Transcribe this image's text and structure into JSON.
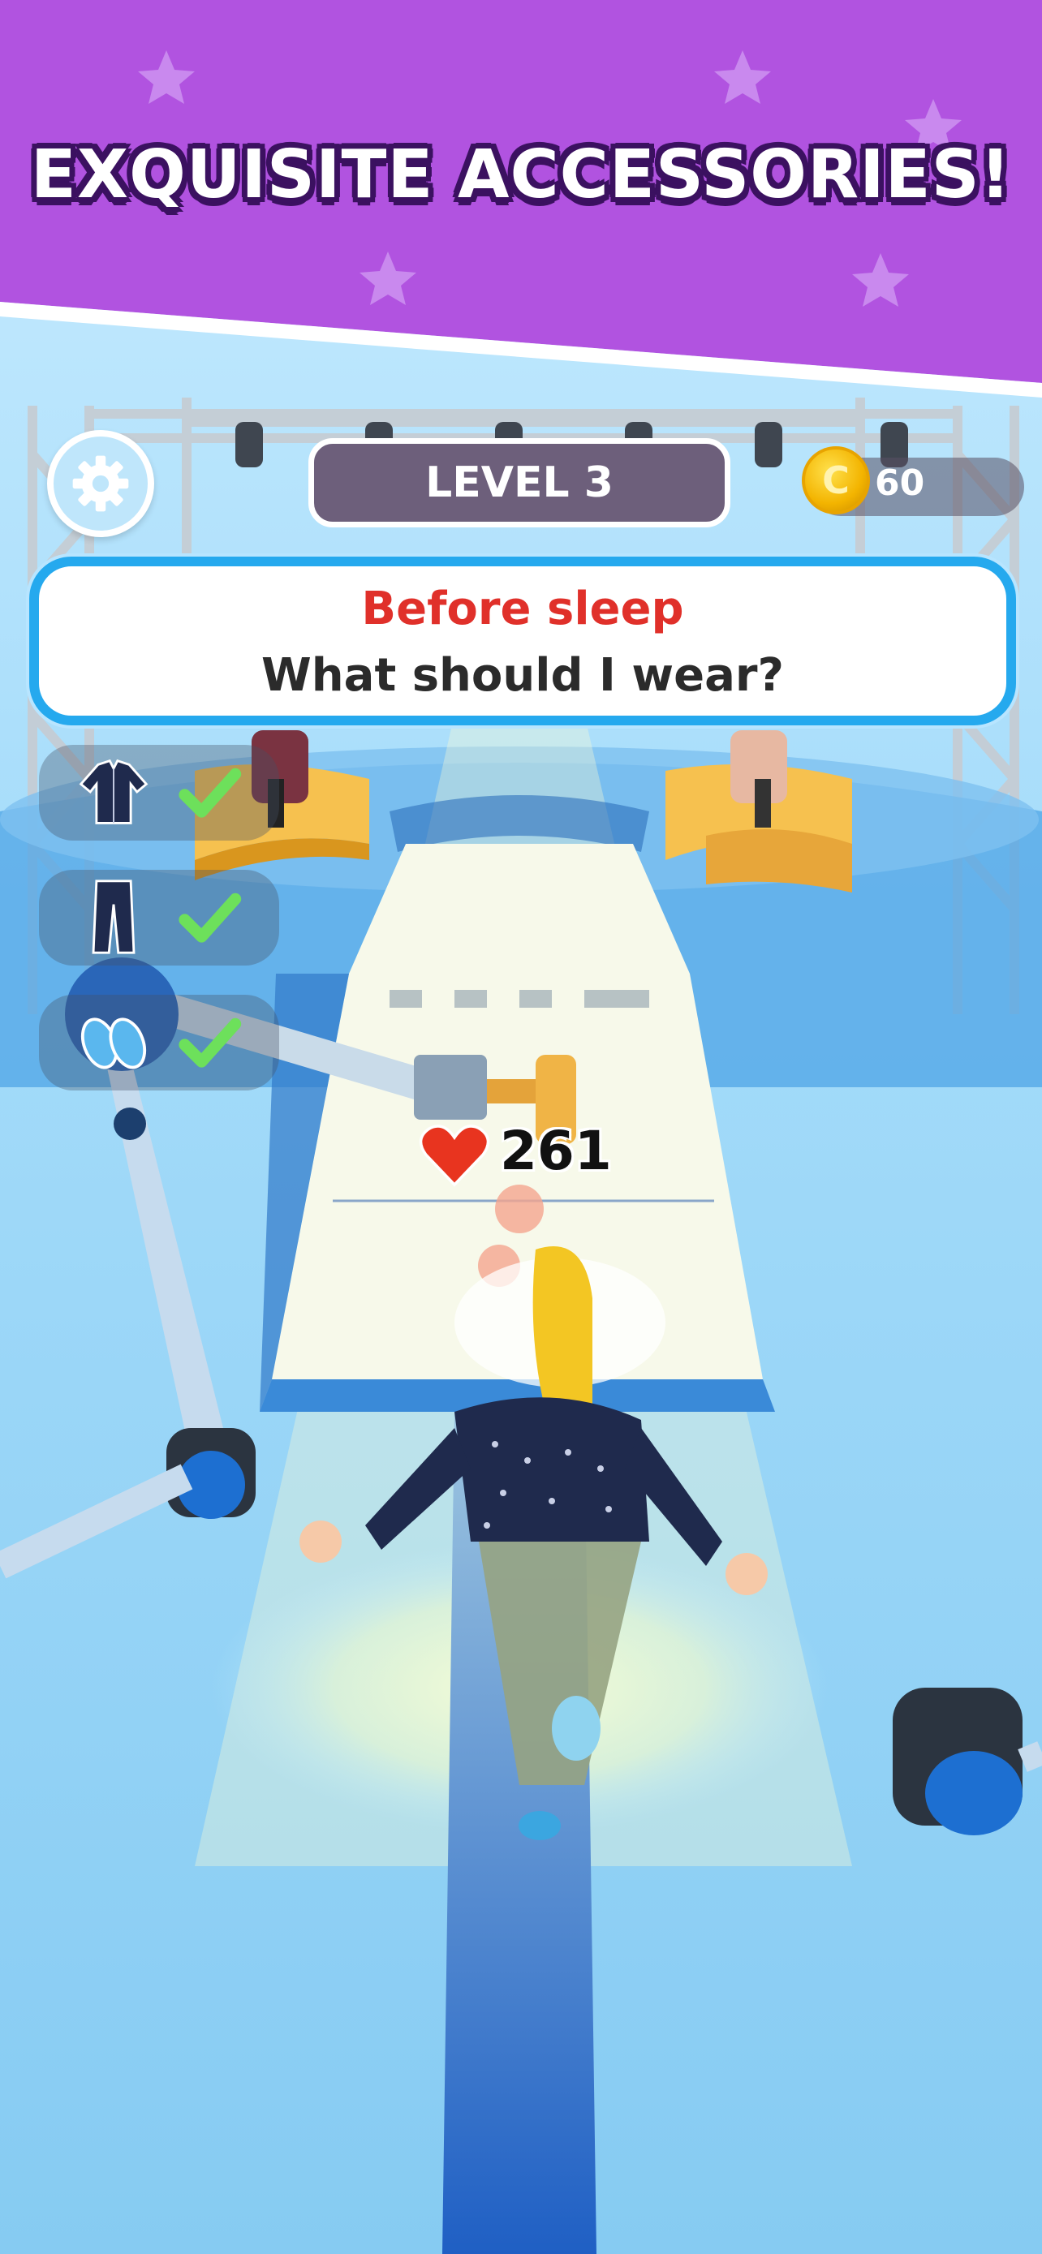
{
  "banner": {
    "title": "EXQUISITE ACCESSORIES!",
    "colors": {
      "background": "#b153e0",
      "text": "#ffffff",
      "outline": "#3b1160"
    }
  },
  "hud": {
    "settings_icon": "gear-icon",
    "level_label": "LEVEL 3",
    "coin_symbol": "C",
    "coins": "60"
  },
  "question": {
    "title": "Before sleep",
    "text": "What should I wear?"
  },
  "outfit_slots": [
    {
      "item": "pajama-shirt-icon",
      "status": "check-icon"
    },
    {
      "item": "pajama-pants-icon",
      "status": "check-icon"
    },
    {
      "item": "slippers-icon",
      "status": "check-icon"
    }
  ],
  "score": {
    "icon": "heart-icon",
    "value": "261"
  },
  "colors": {
    "accent_blue": "#25a9ee",
    "question_red": "#e0302a",
    "check_green": "#6de05b",
    "heart_red": "#e8341f"
  }
}
